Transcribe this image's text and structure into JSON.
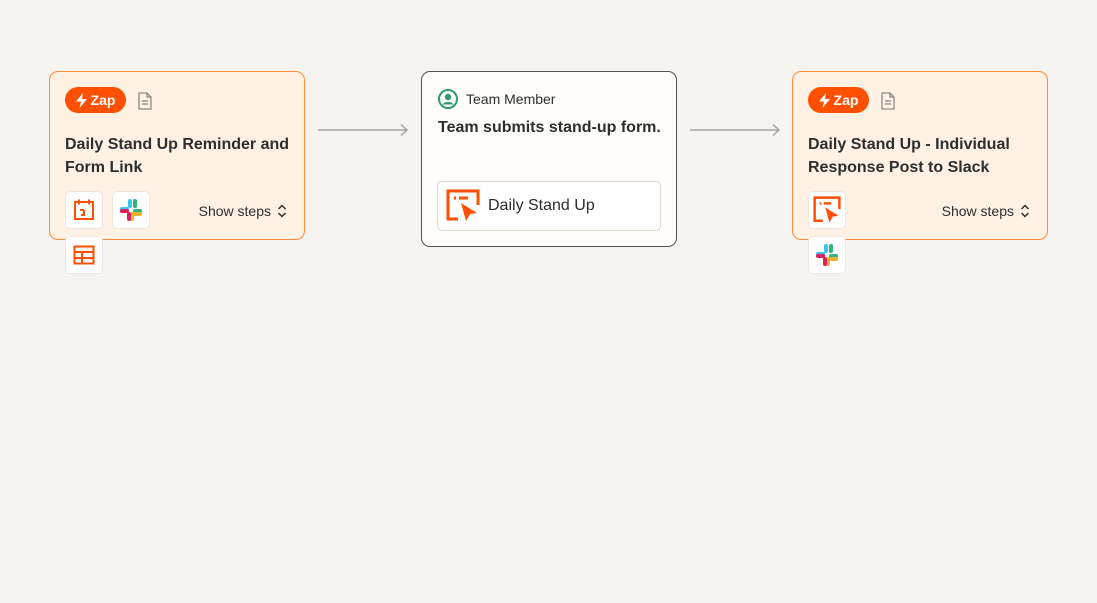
{
  "colors": {
    "background": "#f6f4f0",
    "zap_orange": "#ff4f00",
    "zap_card_bg": "#fff1e4",
    "zap_card_border": "#ff8a3d",
    "member_green": "#2f9e6e"
  },
  "zap1": {
    "badge": "Zap",
    "badge_icon": "lightning-icon",
    "title": "Daily Stand Up Reminder and Form Link",
    "apps": [
      "schedule-icon",
      "slack-icon",
      "tables-icon"
    ],
    "show_steps": "Show steps"
  },
  "form": {
    "role": "Team Member",
    "role_icon": "user-circle-icon",
    "title": "Team submits stand-up form.",
    "form_name": "Daily Stand Up",
    "form_icon": "interfaces-icon"
  },
  "zap2": {
    "badge": "Zap",
    "badge_icon": "lightning-icon",
    "title": "Daily Stand Up - Individual Response Post to Slack",
    "apps": [
      "interfaces-icon",
      "slack-icon"
    ],
    "show_steps": "Show steps"
  }
}
